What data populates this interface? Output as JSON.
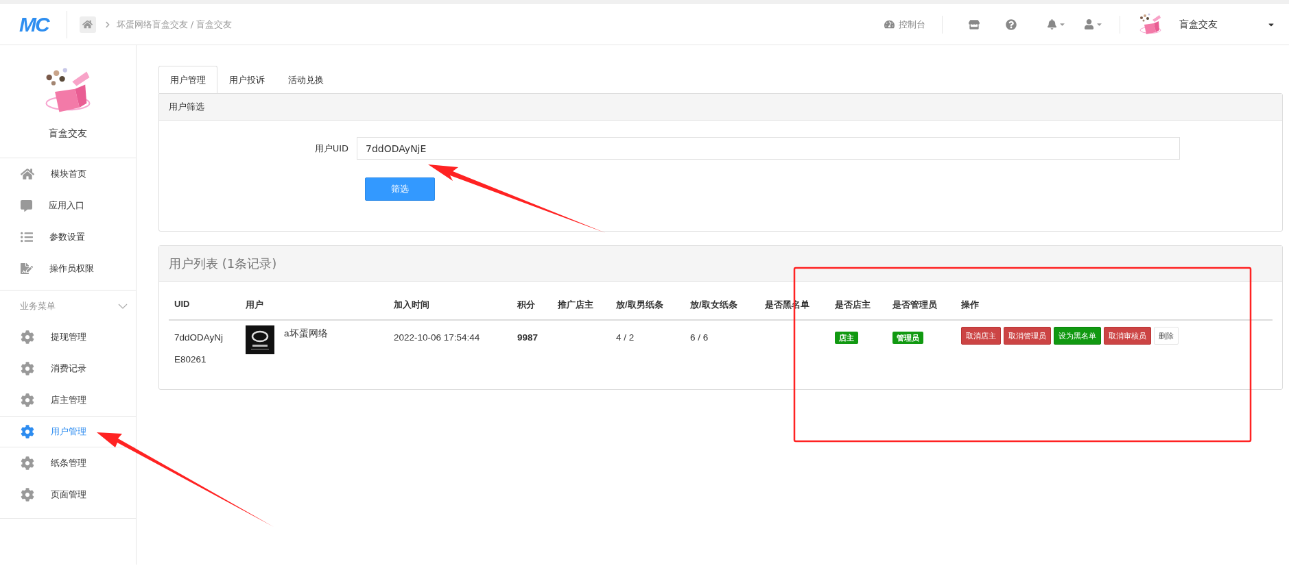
{
  "header": {
    "logo": "MC",
    "breadcrumb": "坏蛋网络盲盒交友 / 盲盒交友",
    "console": "控制台",
    "account": "盲盒交友"
  },
  "sidebar": {
    "profile_name": "盲盒交友",
    "items": [
      {
        "label": "模块首页",
        "selected": false
      },
      {
        "label": "应用入口",
        "selected": false
      },
      {
        "label": "参数设置",
        "selected": false
      },
      {
        "label": "操作员权限",
        "selected": false
      }
    ],
    "group": {
      "label": "业务菜单",
      "expanded": true,
      "items": [
        {
          "label": "提现管理",
          "selected": false
        },
        {
          "label": "消费记录",
          "selected": false
        },
        {
          "label": "店主管理",
          "selected": false
        },
        {
          "label": "用户管理",
          "selected": true
        },
        {
          "label": "纸条管理",
          "selected": false
        },
        {
          "label": "页面管理",
          "selected": false
        }
      ]
    }
  },
  "tabs": [
    {
      "label": "用户管理",
      "selected": true
    },
    {
      "label": "用户投诉",
      "selected": false
    },
    {
      "label": "活动兑换",
      "selected": false
    }
  ],
  "filter": {
    "title": "用户筛选",
    "uid_label": "用户UID",
    "uid_value": "7ddODAyNjE",
    "button": "筛选"
  },
  "user_list": {
    "title": "用户列表 (1条记录)",
    "columns": [
      "UID",
      "用户",
      "加入时间",
      "积分",
      "推广店主",
      "放/取男纸条",
      "放/取女纸条",
      "是否黑名单",
      "是否店主",
      "是否管理员",
      "操作"
    ],
    "rows": [
      {
        "uid": "7ddODAyNjE80261",
        "user": "a坏蛋网络",
        "joined": "2022-10-06 17:54:44",
        "points": "9987",
        "promoter": "",
        "male_notes": "4 / 2",
        "female_notes": "6 / 6",
        "blacklist": "",
        "owner_badge": {
          "label": "店主",
          "kind": "success"
        },
        "admin_badge": {
          "label": "管理员",
          "kind": "success"
        },
        "actions": [
          {
            "label": "取消店主",
            "kind": "danger"
          },
          {
            "label": "取消管理员",
            "kind": "danger"
          },
          {
            "label": "设为黑名单",
            "kind": "success"
          },
          {
            "label": "取消审核员",
            "kind": "danger"
          },
          {
            "label": "删除",
            "kind": "default"
          }
        ]
      }
    ]
  }
}
